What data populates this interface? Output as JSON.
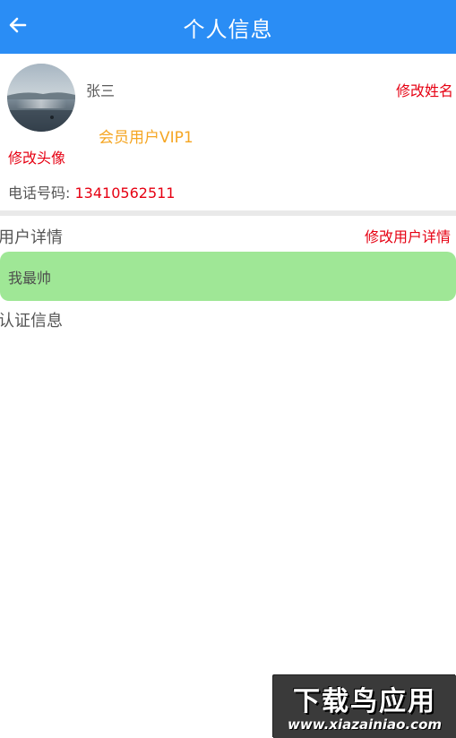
{
  "header": {
    "title": "个人信息",
    "back_icon": "arrow-left-icon",
    "background_color": "#2a8df5"
  },
  "profile": {
    "name": "张三",
    "edit_name_label": "修改姓名",
    "membership": "会员用户VIP1",
    "edit_avatar_label": "修改头像",
    "phone_label": "电话号码:",
    "phone_number": "13410562511"
  },
  "user_detail": {
    "section_title": "用户详情",
    "edit_label": "修改用户详情",
    "bio": "我最帅"
  },
  "certification": {
    "section_title": "认证信息"
  },
  "watermark": {
    "title": "下载鸟应用",
    "url": "www.xiazainiao.com"
  },
  "colors": {
    "accent_red": "#e60012",
    "vip_gold": "#f5a623",
    "bio_green": "#9fe796"
  }
}
